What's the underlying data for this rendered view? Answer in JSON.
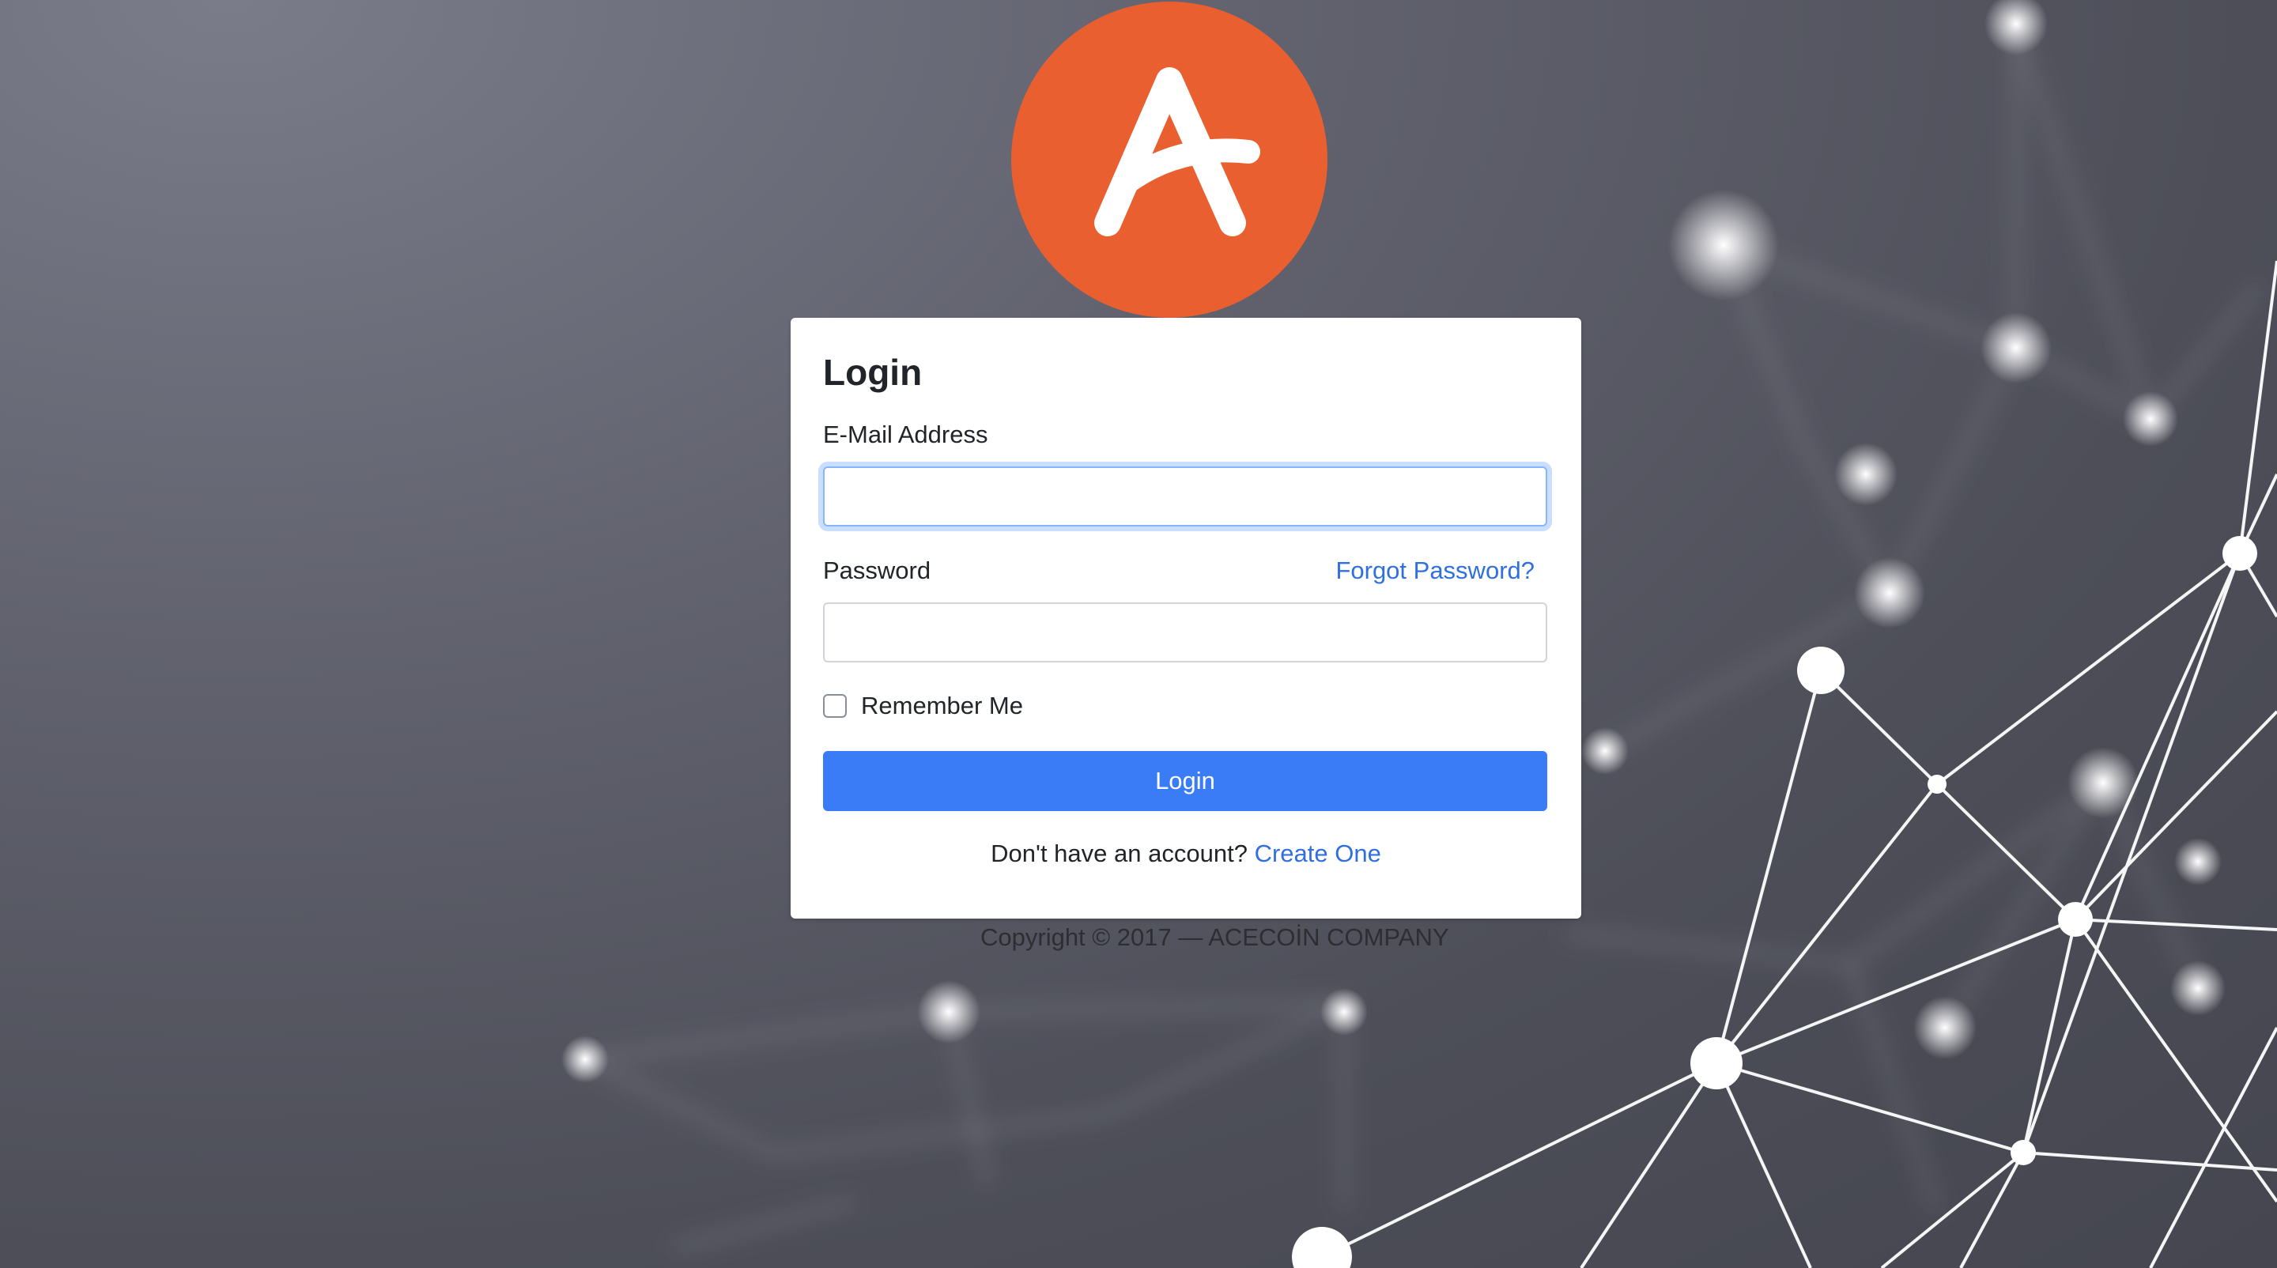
{
  "logo": {
    "letter": "A",
    "color": "#e95f30"
  },
  "login": {
    "title": "Login",
    "email_label": "E-Mail Address",
    "email_value": "",
    "password_label": "Password",
    "password_value": "",
    "forgot_label": "Forgot Password?",
    "remember_label": "Remember Me",
    "submit_label": "Login",
    "signup_prompt": "Don't have an account?",
    "signup_link": "Create One"
  },
  "footer": {
    "copyright": "Copyright © 2017 — ACECOİN COMPANY"
  },
  "colors": {
    "accent": "#3a7cf5",
    "link": "#2f6fe0",
    "brand": "#e95f30"
  }
}
